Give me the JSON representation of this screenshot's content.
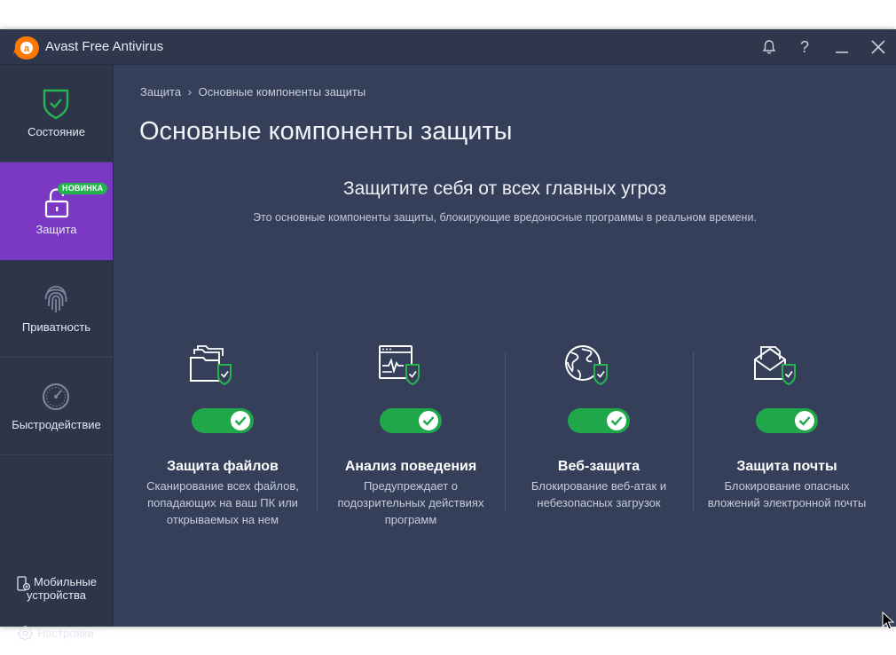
{
  "app": {
    "title": "Avast Free Antivirus",
    "accent_color": "#7a38c4",
    "toggle_color": "#1fa74a"
  },
  "titlebar": {
    "buttons": [
      "bell-icon",
      "help-icon",
      "minimize-icon",
      "close-icon"
    ],
    "help_label": "?"
  },
  "sidebar": {
    "items": [
      {
        "label": "Состояние",
        "icon": "shield-check-icon",
        "active": false
      },
      {
        "label": "Защита",
        "icon": "lock-icon",
        "active": true,
        "badge": "НОВИНКА"
      },
      {
        "label": "Приватность",
        "icon": "fingerprint-icon",
        "active": false
      },
      {
        "label": "Быстродействие",
        "icon": "speedometer-icon",
        "active": false
      }
    ],
    "bottom": {
      "mobile": {
        "label_line1": "Мобильные",
        "label_line2": "устройства",
        "icon": "mobile-device-icon"
      },
      "settings": {
        "label": "Настройки",
        "icon": "gear-icon"
      }
    }
  },
  "main": {
    "breadcrumb": {
      "root": "Защита",
      "separator": "›",
      "current": "Основные компоненты защиты"
    },
    "title": "Основные компоненты защиты",
    "headline": "Защитите себя от всех главных угроз",
    "subline": "Это основные компоненты защиты, блокирующие вредоносные программы в реальном времени.",
    "components": [
      {
        "title": "Защита файлов",
        "desc": "Сканирование всех файлов, попадающих на ваш ПК или открываемых на нем",
        "icon": "folder-shield-icon",
        "enabled": true
      },
      {
        "title": "Анализ поведения",
        "desc": "Предупреждает о подозрительных действиях программ",
        "icon": "window-pulse-icon",
        "enabled": true
      },
      {
        "title": "Веб-защита",
        "desc": "Блокирование веб-атак и небезопасных загрузок",
        "icon": "globe-shield-icon",
        "enabled": true
      },
      {
        "title": "Защита почты",
        "desc": "Блокирование опасных вложений электронной почты",
        "icon": "envelope-shield-icon",
        "enabled": true
      }
    ]
  }
}
